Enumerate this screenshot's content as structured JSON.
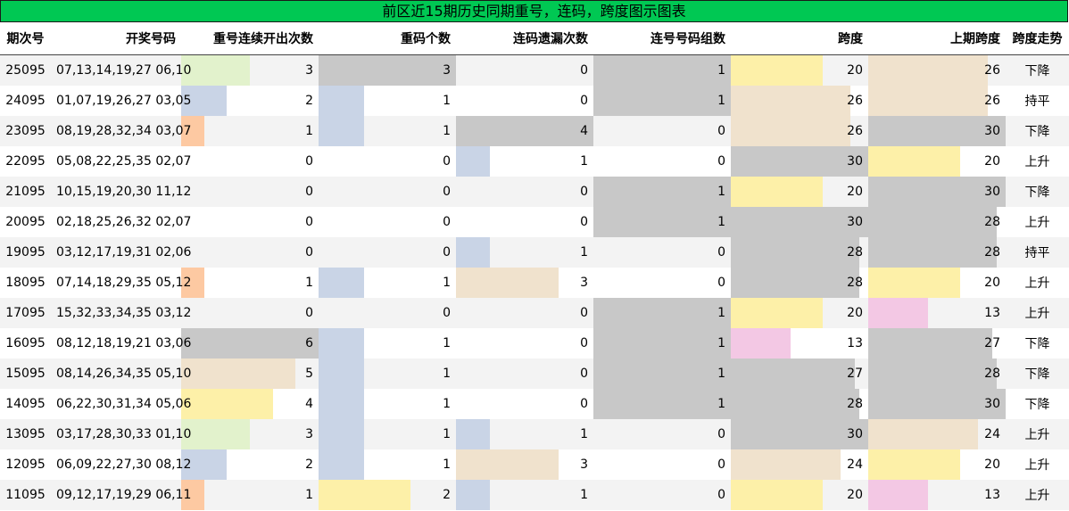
{
  "title": "前区近15期历史同期重号，连码，跨度图示图表",
  "headers": [
    "期次号",
    "开奖号码",
    "重号连续开出次数",
    "重码个数",
    "连码遗漏次数",
    "连号号码组数",
    "跨度",
    "上期跨度",
    "跨度走势"
  ],
  "colors": {
    "header_bg": "#00c853",
    "gray": "#c8c8c8",
    "green": "#e2f2cc",
    "blue": "#c9d4e6",
    "orange": "#fdc9a2",
    "tan": "#f0e2cd",
    "yellow": "#fdf0a8",
    "pink": "#f3c8e4"
  },
  "rows": [
    {
      "issue": "25095",
      "draw": "07,13,14,19,27 06,10",
      "repeat_streak": "3",
      "repeat_count": "3",
      "consec_miss": "0",
      "consec_groups": "1",
      "span": "20",
      "prev_span": "26",
      "trend": "下降"
    },
    {
      "issue": "24095",
      "draw": "01,07,19,26,27 03,05",
      "repeat_streak": "2",
      "repeat_count": "1",
      "consec_miss": "0",
      "consec_groups": "1",
      "span": "26",
      "prev_span": "26",
      "trend": "持平"
    },
    {
      "issue": "23095",
      "draw": "08,19,28,32,34 03,07",
      "repeat_streak": "1",
      "repeat_count": "1",
      "consec_miss": "4",
      "consec_groups": "0",
      "span": "26",
      "prev_span": "30",
      "trend": "下降"
    },
    {
      "issue": "22095",
      "draw": "05,08,22,25,35 02,07",
      "repeat_streak": "0",
      "repeat_count": "0",
      "consec_miss": "1",
      "consec_groups": "0",
      "span": "30",
      "prev_span": "20",
      "trend": "上升"
    },
    {
      "issue": "21095",
      "draw": "10,15,19,20,30 11,12",
      "repeat_streak": "0",
      "repeat_count": "0",
      "consec_miss": "0",
      "consec_groups": "1",
      "span": "20",
      "prev_span": "30",
      "trend": "下降"
    },
    {
      "issue": "20095",
      "draw": "02,18,25,26,32 02,07",
      "repeat_streak": "0",
      "repeat_count": "0",
      "consec_miss": "0",
      "consec_groups": "1",
      "span": "30",
      "prev_span": "28",
      "trend": "上升"
    },
    {
      "issue": "19095",
      "draw": "03,12,17,19,31 02,06",
      "repeat_streak": "0",
      "repeat_count": "0",
      "consec_miss": "1",
      "consec_groups": "0",
      "span": "28",
      "prev_span": "28",
      "trend": "持平"
    },
    {
      "issue": "18095",
      "draw": "07,14,18,29,35 05,12",
      "repeat_streak": "1",
      "repeat_count": "1",
      "consec_miss": "3",
      "consec_groups": "0",
      "span": "28",
      "prev_span": "20",
      "trend": "上升"
    },
    {
      "issue": "17095",
      "draw": "15,32,33,34,35 03,12",
      "repeat_streak": "0",
      "repeat_count": "0",
      "consec_miss": "0",
      "consec_groups": "1",
      "span": "20",
      "prev_span": "13",
      "trend": "上升"
    },
    {
      "issue": "16095",
      "draw": "08,12,18,19,21 03,06",
      "repeat_streak": "6",
      "repeat_count": "1",
      "consec_miss": "0",
      "consec_groups": "1",
      "span": "13",
      "prev_span": "27",
      "trend": "下降"
    },
    {
      "issue": "15095",
      "draw": "08,14,26,34,35 05,10",
      "repeat_streak": "5",
      "repeat_count": "1",
      "consec_miss": "0",
      "consec_groups": "1",
      "span": "27",
      "prev_span": "28",
      "trend": "下降"
    },
    {
      "issue": "14095",
      "draw": "06,22,30,31,34 05,06",
      "repeat_streak": "4",
      "repeat_count": "1",
      "consec_miss": "0",
      "consec_groups": "1",
      "span": "28",
      "prev_span": "30",
      "trend": "下降"
    },
    {
      "issue": "13095",
      "draw": "03,17,28,30,33 01,10",
      "repeat_streak": "3",
      "repeat_count": "1",
      "consec_miss": "1",
      "consec_groups": "0",
      "span": "30",
      "prev_span": "24",
      "trend": "上升"
    },
    {
      "issue": "12095",
      "draw": "06,09,22,27,30 08,12",
      "repeat_streak": "2",
      "repeat_count": "1",
      "consec_miss": "3",
      "consec_groups": "0",
      "span": "24",
      "prev_span": "20",
      "trend": "上升"
    },
    {
      "issue": "11095",
      "draw": "09,12,17,19,29 06,11",
      "repeat_streak": "1",
      "repeat_count": "2",
      "consec_miss": "1",
      "consec_groups": "0",
      "span": "20",
      "prev_span": "13",
      "trend": "上升"
    }
  ]
}
